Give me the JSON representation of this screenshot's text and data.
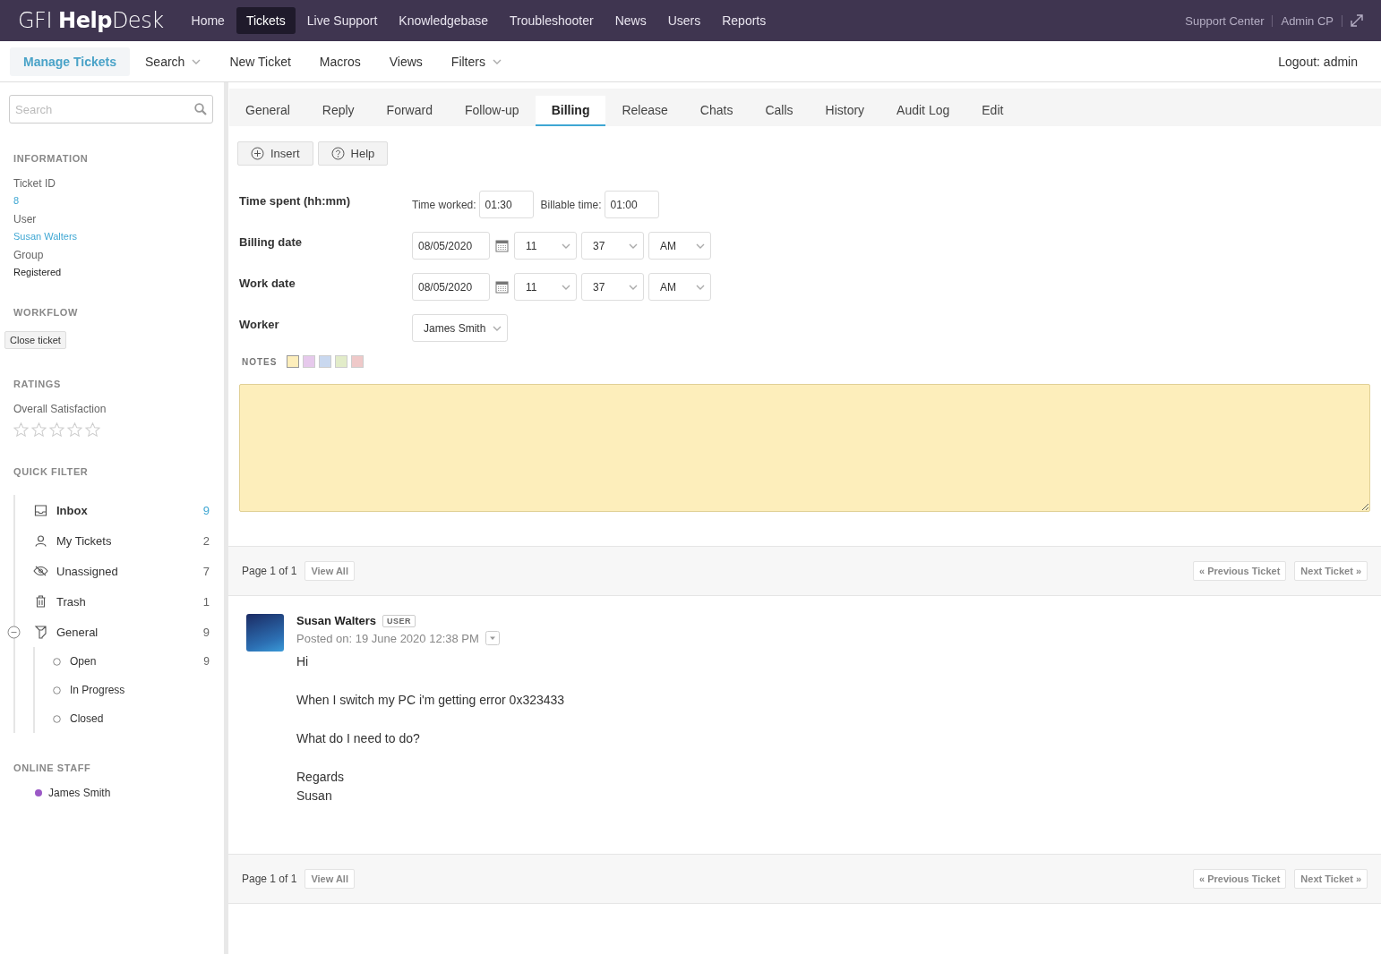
{
  "header": {
    "logo": "GFI **Help**Desk",
    "nav": [
      {
        "label": "Home",
        "selected": false
      },
      {
        "label": "Tickets",
        "selected": true
      },
      {
        "label": "Live Support",
        "selected": false
      },
      {
        "label": "Knowledgebase",
        "selected": false
      },
      {
        "label": "Troubleshooter",
        "selected": false
      },
      {
        "label": "News",
        "selected": false
      },
      {
        "label": "Users",
        "selected": false
      },
      {
        "label": "Reports",
        "selected": false
      }
    ],
    "links": [
      "Support Center",
      "Admin CP"
    ]
  },
  "subnav": {
    "items": [
      {
        "label": "Manage Tickets",
        "selected": true,
        "dropdown": false
      },
      {
        "label": "Search",
        "selected": false,
        "dropdown": true
      },
      {
        "label": "New Ticket",
        "selected": false,
        "dropdown": false
      },
      {
        "label": "Macros",
        "selected": false,
        "dropdown": false
      },
      {
        "label": "Views",
        "selected": false,
        "dropdown": false
      },
      {
        "label": "Filters",
        "selected": false,
        "dropdown": true
      }
    ],
    "logout": "Logout: admin"
  },
  "sidebar": {
    "search": {
      "placeholder": "Search"
    },
    "information": {
      "heading": "INFORMATION",
      "fields": [
        {
          "label": "Ticket ID",
          "value": "8",
          "kind": "link"
        },
        {
          "label": "User",
          "value": "Susan Walters",
          "kind": "link"
        },
        {
          "label": "Group",
          "value": "Registered",
          "kind": "plain"
        }
      ]
    },
    "workflow": {
      "heading": "WORKFLOW",
      "button": "Close ticket"
    },
    "ratings": {
      "heading": "RATINGS",
      "label": "Overall Satisfaction",
      "stars": 0
    },
    "quick_filter": {
      "heading": "QUICK FILTER",
      "items": [
        {
          "label": "Inbox",
          "count": "9",
          "kind": "inbox",
          "selected": true
        },
        {
          "label": "My Tickets",
          "count": "2",
          "kind": "person",
          "selected": false
        },
        {
          "label": "Unassigned",
          "count": "7",
          "kind": "hidden",
          "selected": false
        },
        {
          "label": "Trash",
          "count": "1",
          "kind": "trash",
          "selected": false
        },
        {
          "label": "General",
          "count": "9",
          "kind": "department",
          "selected": false,
          "expanded": true,
          "children": [
            {
              "label": "Open",
              "count": "9"
            },
            {
              "label": "In Progress"
            },
            {
              "label": "Closed"
            }
          ]
        }
      ]
    },
    "online_staff": {
      "heading": "ONLINE STAFF",
      "staff": [
        {
          "name": "James Smith",
          "color": "#9b59c6"
        }
      ]
    }
  },
  "tabs": [
    {
      "label": "General",
      "selected": false
    },
    {
      "label": "Reply",
      "selected": false
    },
    {
      "label": "Forward",
      "selected": false
    },
    {
      "label": "Follow-up",
      "selected": false
    },
    {
      "label": "Billing",
      "selected": true
    },
    {
      "label": "Release",
      "selected": false
    },
    {
      "label": "Chats",
      "selected": false
    },
    {
      "label": "Calls",
      "selected": false
    },
    {
      "label": "History",
      "selected": false
    },
    {
      "label": "Audit Log",
      "selected": false
    },
    {
      "label": "Edit",
      "selected": false
    }
  ],
  "toolbar": [
    {
      "label": "Insert",
      "kind": "insert"
    },
    {
      "label": "Help",
      "kind": "help"
    }
  ],
  "billing": {
    "time_spent": {
      "label": "Time spent (hh:mm)",
      "worked_label": "Time worked:",
      "worked": "01:30",
      "billable_label": "Billable time:",
      "billable": "01:00"
    },
    "dates": [
      {
        "label": "Billing date",
        "date": "08/05/2020",
        "hour": "11",
        "minute": "37",
        "ampm": "AM"
      },
      {
        "label": "Work date",
        "date": "08/05/2020",
        "hour": "11",
        "minute": "37",
        "ampm": "AM"
      }
    ],
    "worker": {
      "label": "Worker",
      "value": "James Smith"
    },
    "notes": {
      "heading": "NOTES",
      "colors": [
        {
          "color": "#fdeebb",
          "selected": true
        },
        {
          "color": "#e6c9ec",
          "selected": false
        },
        {
          "color": "#c9d8ef",
          "selected": false
        },
        {
          "color": "#e2ecc9",
          "selected": false
        },
        {
          "color": "#efc9c9",
          "selected": false
        }
      ]
    }
  },
  "pager_top": {
    "page": "Page 1 of 1",
    "view_all": "View All",
    "previous": "« Previous Ticket",
    "next": "Next Ticket »"
  },
  "post": {
    "author": "Susan Walters",
    "badge": "USER",
    "posted": "Posted on: 19 June 2020 12:38 PM",
    "paragraphs": [
      [
        "Hi"
      ],
      [
        "When I switch my PC i'm getting error 0x323433"
      ],
      [
        "What do I need to do?"
      ],
      [
        "Regards",
        "Susan"
      ]
    ]
  },
  "pager_bottom": {
    "page": "Page 1 of 1",
    "view_all": "View All",
    "previous": "« Previous Ticket",
    "next": "Next Ticket »"
  }
}
